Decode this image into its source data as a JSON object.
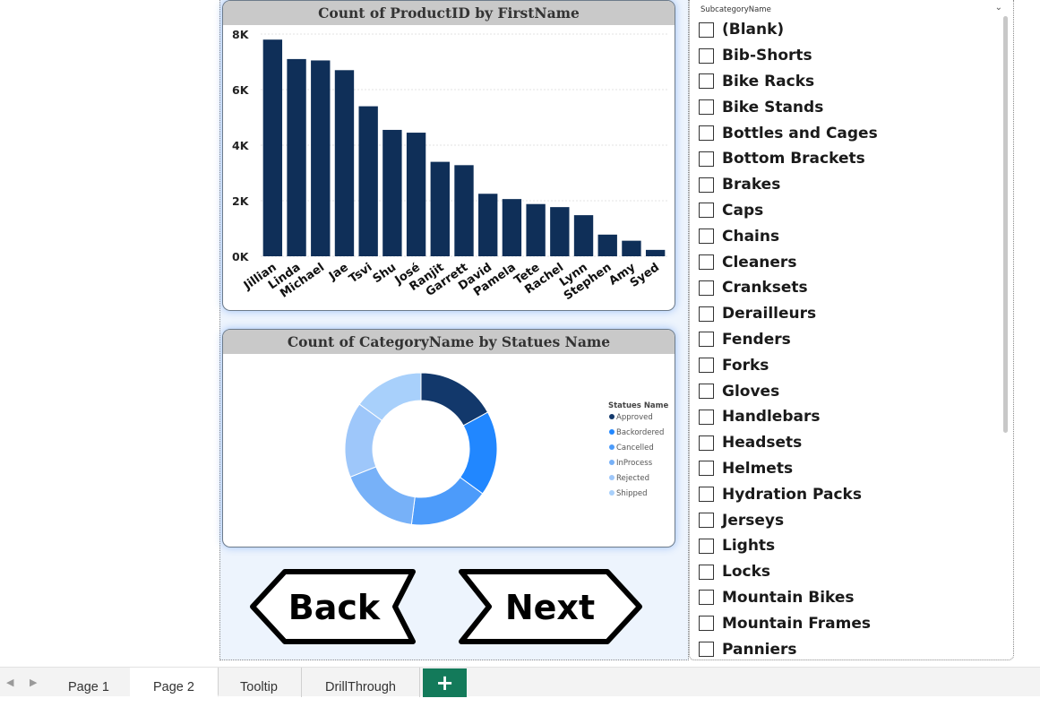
{
  "bar_chart": {
    "title": "Count of ProductID by FirstName"
  },
  "donut_chart": {
    "title": "Count of CategoryName by Statues Name",
    "legend_title": "Statues Name"
  },
  "chart_data": [
    {
      "type": "bar",
      "title": "Count of ProductID by FirstName",
      "categories": [
        "Jillian",
        "Linda",
        "Michael",
        "Jae",
        "Tsvi",
        "Shu",
        "José",
        "Ranjit",
        "Garrett",
        "David",
        "Pamela",
        "Tete",
        "Rachel",
        "Lynn",
        "Stephen",
        "Amy",
        "Syed"
      ],
      "values": [
        7800,
        7100,
        7050,
        6700,
        5400,
        4550,
        4450,
        3400,
        3280,
        2250,
        2060,
        1880,
        1770,
        1480,
        780,
        560,
        230
      ],
      "ylim": [
        0,
        8000
      ],
      "yticks": [
        "0K",
        "2K",
        "4K",
        "6K",
        "8K"
      ],
      "grid": true,
      "colors": {
        "bar": "#0f2f58",
        "grid": "#e3e3e3"
      }
    },
    {
      "type": "pie",
      "title": "Count of CategoryName by Statues Name",
      "legend_title": "Statues Name",
      "legend_position": "right",
      "categories": [
        "Approved",
        "Backordered",
        "Cancelled",
        "InProcess",
        "Rejected",
        "Shipped"
      ],
      "values": [
        17,
        18,
        17,
        17,
        16,
        15
      ],
      "colors": [
        "#12386b",
        "#2187ff",
        "#4c9bfa",
        "#77b1f8",
        "#9ec7fa",
        "#a8d0fb"
      ]
    }
  ],
  "nav_buttons": {
    "back": "Back",
    "next": "Next"
  },
  "slicer": {
    "title": "SubcategoryName",
    "items": [
      "(Blank)",
      "Bib-Shorts",
      "Bike Racks",
      "Bike Stands",
      "Bottles and Cages",
      "Bottom Brackets",
      "Brakes",
      "Caps",
      "Chains",
      "Cleaners",
      "Cranksets",
      "Derailleurs",
      "Fenders",
      "Forks",
      "Gloves",
      "Handlebars",
      "Headsets",
      "Helmets",
      "Hydration Packs",
      "Jerseys",
      "Lights",
      "Locks",
      "Mountain Bikes",
      "Mountain Frames",
      "Panniers"
    ]
  },
  "tabs": {
    "items": [
      "Page 1",
      "Page 2",
      "Tooltip",
      "DrillThrough"
    ],
    "active": "Page 2",
    "add": "+"
  },
  "icons": {
    "prev": "chevron-left-icon",
    "next": "chevron-right-icon",
    "dropdown": "chevron-down-icon",
    "add": "plus-icon"
  }
}
